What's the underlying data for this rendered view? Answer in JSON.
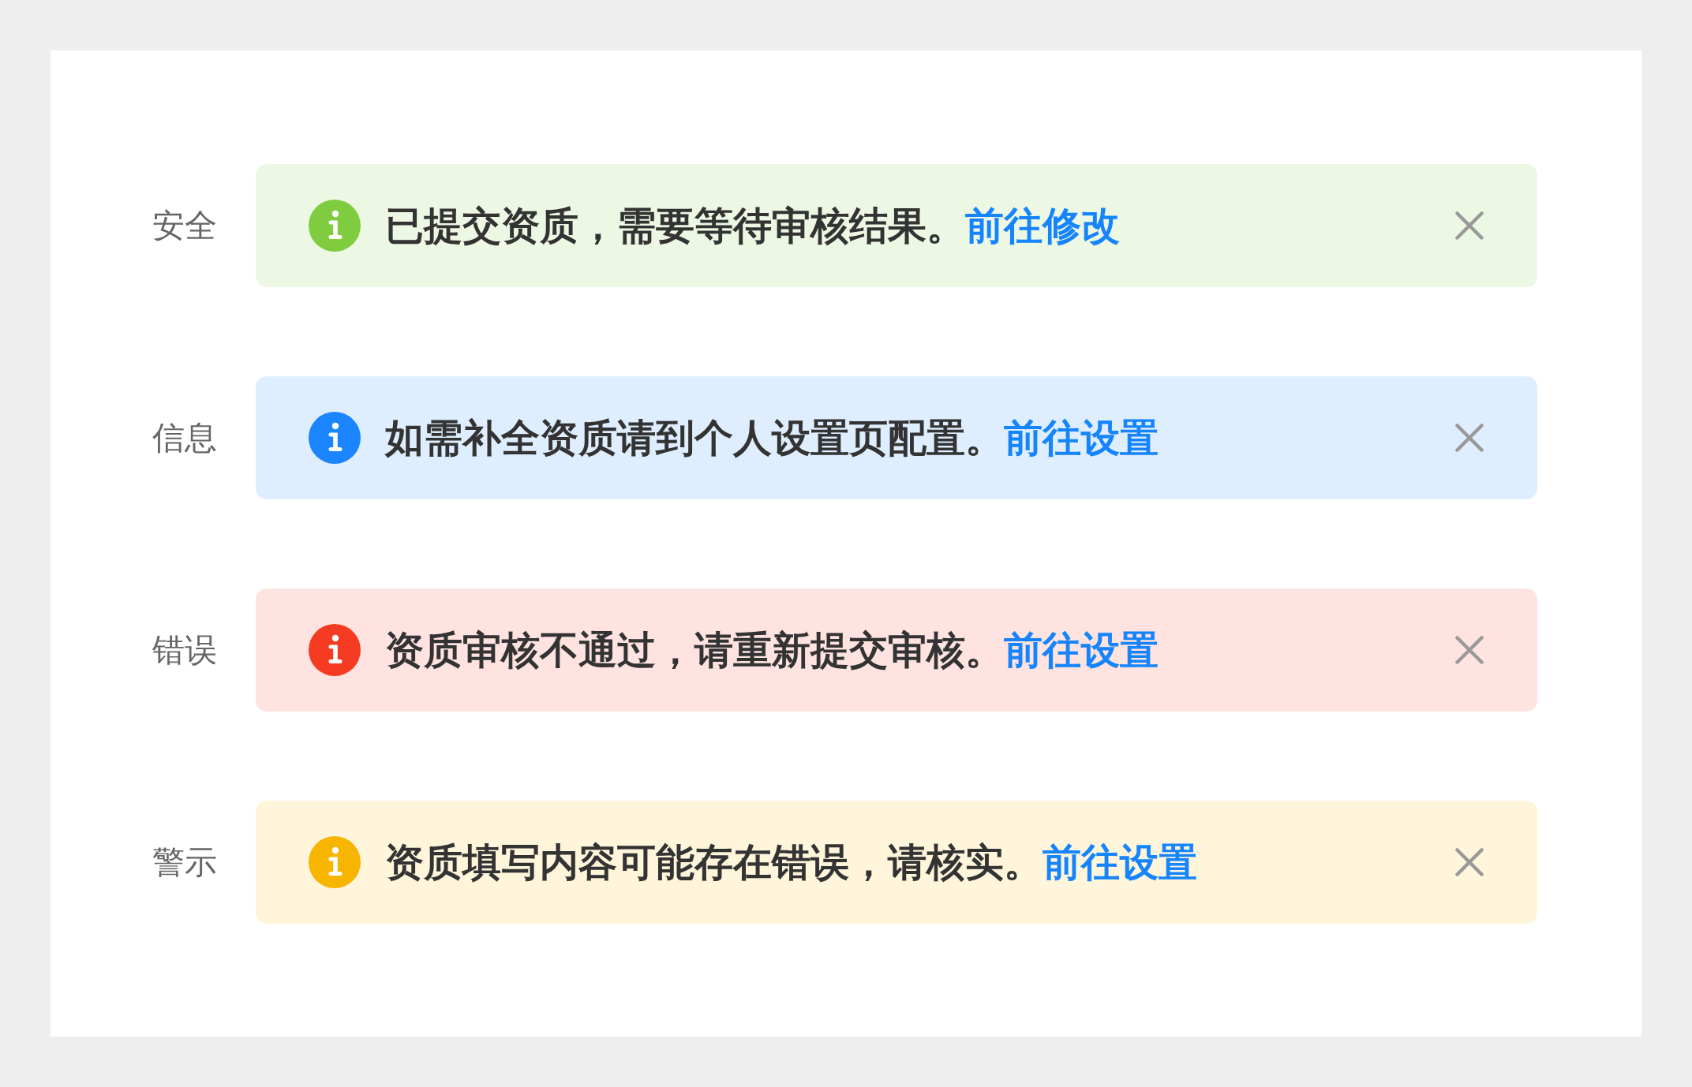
{
  "alerts": [
    {
      "label": "安全",
      "color": "#7fcc3f",
      "message": "已提交资质，需要等待审核结果。",
      "link": "前往修改"
    },
    {
      "label": "信息",
      "color": "#1a85ff",
      "message": "如需补全资质请到个人设置页配置。",
      "link": "前往设置"
    },
    {
      "label": "错误",
      "color": "#f53c22",
      "message": "资质审核不通过，请重新提交审核。",
      "link": "前往设置"
    },
    {
      "label": "警示",
      "color": "#f7b500",
      "message": "资质填写内容可能存在错误，请核实。",
      "link": "前往设置"
    }
  ]
}
